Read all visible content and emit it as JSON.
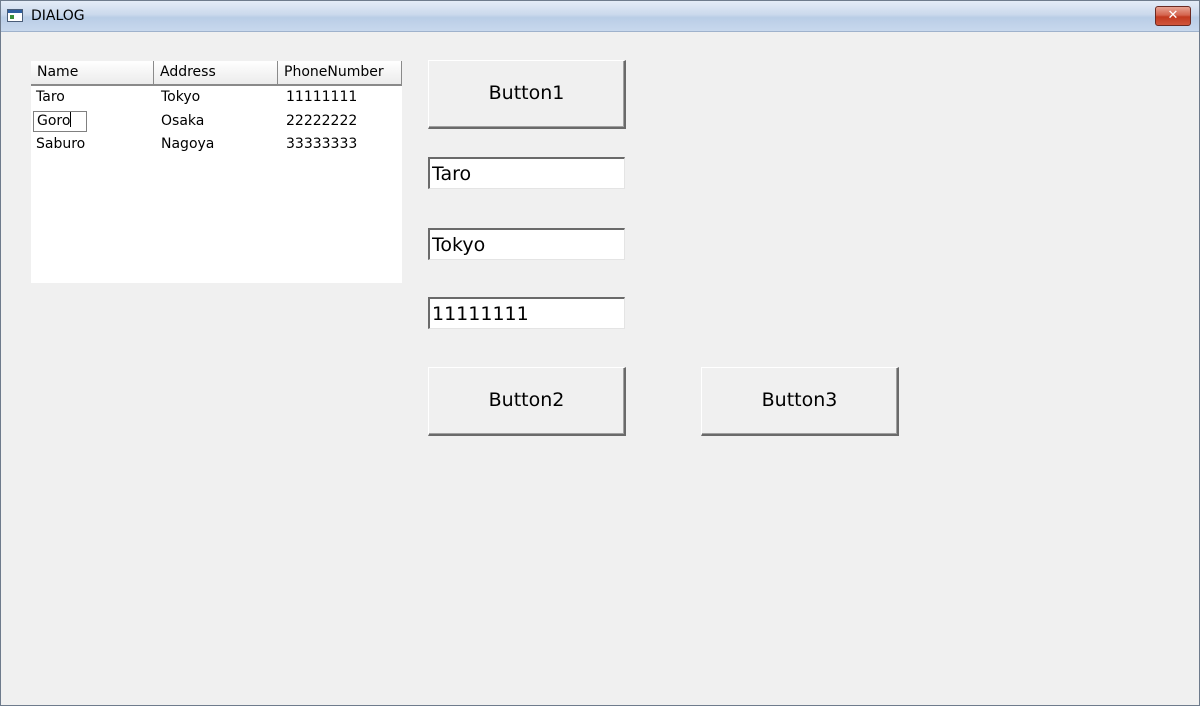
{
  "window": {
    "title": "DIALOG",
    "close_glyph": "✕"
  },
  "listview": {
    "columns": [
      "Name",
      "Address",
      "PhoneNumber"
    ],
    "rows": [
      [
        "Taro",
        "Tokyo",
        "11111111"
      ],
      [
        "Goro",
        "Osaka",
        "22222222"
      ],
      [
        "Saburo",
        "Nagoya",
        "33333333"
      ]
    ]
  },
  "buttons": {
    "button1": "Button1",
    "button2": "Button2",
    "button3": "Button3"
  },
  "fields": {
    "name_value": "Taro",
    "address_value": "Tokyo",
    "phone_value": "11111111"
  },
  "icons": {
    "app": "app-window-icon",
    "close": "close-icon"
  }
}
